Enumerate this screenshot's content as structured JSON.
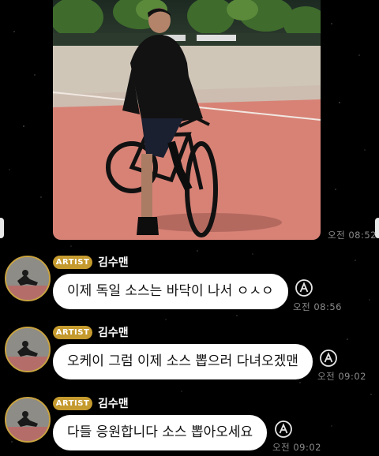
{
  "photo_time": "오전 08:52",
  "messages": [
    {
      "badge": "ARTIST",
      "name": "김수맨",
      "text": "이제 독일 소스는 바닥이 나서 ㅇㅅㅇ",
      "time": "오전 08:56"
    },
    {
      "badge": "ARTIST",
      "name": "김수맨",
      "text": "오케이 그럼 이제 소스 뽑으러 다녀오겠맨",
      "time": "오전 09:02"
    },
    {
      "badge": "ARTIST",
      "name": "김수맨",
      "text": "다들 응원합니다 소스 뽑아오세요",
      "time": "오전 09:02"
    }
  ],
  "icons": {
    "reply": "reply-a-icon",
    "avatar": "artist-avatar"
  },
  "colors": {
    "badge": "#c59a2e",
    "bubble": "#ffffff",
    "background": "#000000"
  }
}
